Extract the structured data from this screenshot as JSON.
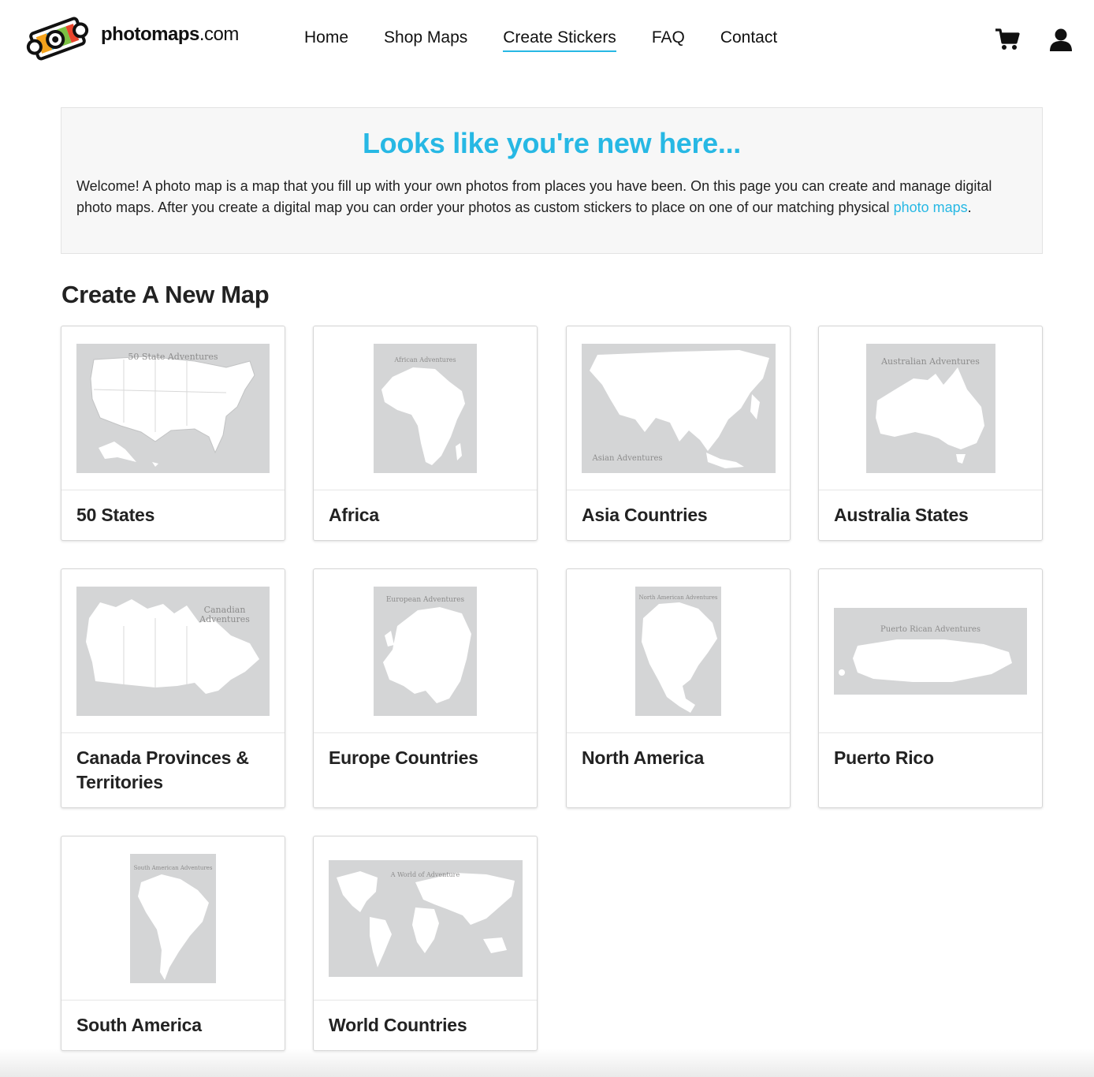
{
  "brand": {
    "name_main": "photomaps",
    "name_tld": ".com"
  },
  "nav": {
    "items": [
      {
        "label": "Home"
      },
      {
        "label": "Shop Maps"
      },
      {
        "label": "Create Stickers",
        "active": true
      },
      {
        "label": "FAQ"
      },
      {
        "label": "Contact"
      }
    ]
  },
  "header_icons": [
    "cart-icon",
    "user-icon"
  ],
  "welcome": {
    "heading": "Looks like you're new here...",
    "text": "Welcome! A photo map is a map that you fill up with your own photos from places you have been. On this page you can create and manage digital photo maps. After you create a digital map you can order your photos as custom stickers to place on one of our matching physical ",
    "link": "photo maps",
    "text_end": "."
  },
  "section": {
    "title": "Create A New Map"
  },
  "maps": [
    {
      "label": "50 States",
      "image_title": "50 State Adventures"
    },
    {
      "label": "Africa",
      "image_title": "African Adventures"
    },
    {
      "label": "Asia Countries",
      "image_title": "Asian Adventures"
    },
    {
      "label": "Australia States",
      "image_title": "Australian Adventures"
    },
    {
      "label": "Canada Provinces & Territories",
      "image_title": "Canadian Adventures"
    },
    {
      "label": "Europe Countries",
      "image_title": "European Adventures"
    },
    {
      "label": "North America",
      "image_title": "North American Adventures"
    },
    {
      "label": "Puerto Rico",
      "image_title": "Puerto Rican Adventures"
    },
    {
      "label": "South America",
      "image_title": "South American Adventures"
    },
    {
      "label": "World Countries",
      "image_title": "A World of Adventure"
    }
  ],
  "colors": {
    "accent": "#27b8e4",
    "thumb_bg": "#d4d5d6",
    "land": "#ffffff"
  }
}
